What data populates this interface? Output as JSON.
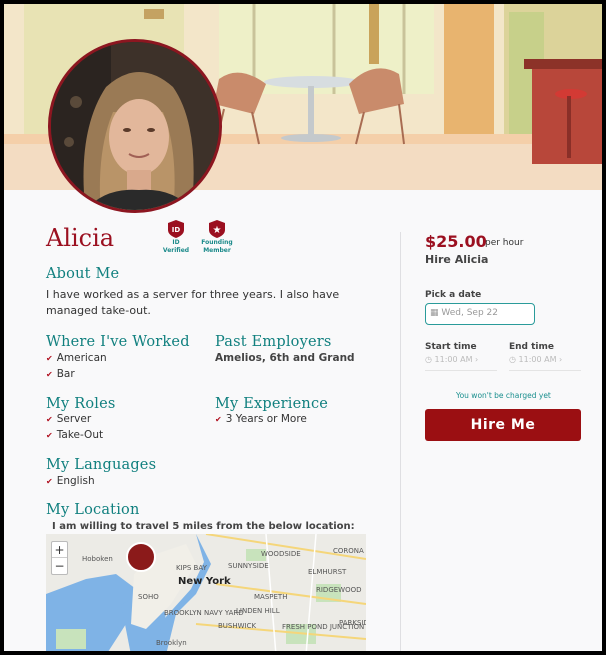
{
  "profile": {
    "name": "Alicia",
    "badges": [
      {
        "icon": "id-shield-icon",
        "label_line1": "ID",
        "label_line2": "Verified"
      },
      {
        "icon": "star-shield-icon",
        "label_line1": "Founding",
        "label_line2": "Member"
      }
    ]
  },
  "about": {
    "heading": "About Me",
    "text_line1": "I have worked as a server for three years. I also have",
    "text_line2": "managed take-out."
  },
  "worked": {
    "heading": "Where I've Worked",
    "items": [
      "American",
      "Bar"
    ]
  },
  "employers": {
    "heading": "Past Employers",
    "text": "Amelios, 6th and Grand"
  },
  "roles": {
    "heading": "My Roles",
    "items": [
      "Server",
      "Take-Out"
    ]
  },
  "experience": {
    "heading": "My Experience",
    "items": [
      "3 Years or More"
    ]
  },
  "languages": {
    "heading": "My Languages",
    "items": [
      "English"
    ]
  },
  "location": {
    "heading": "My Location",
    "note": "I am willing to travel 5 miles from the below location:",
    "map": {
      "city": "New York",
      "labels": [
        "Hoboken",
        "WOODSIDE",
        "SUNNYSIDE",
        "KIPS BAY",
        "ELMHURST",
        "CORONA",
        "RIDGEWOOD",
        "MASPETH",
        "LINDEN HILL",
        "FRESH POND JUNCTION",
        "BROOKLYN NAVY YARD",
        "BUSHWICK",
        "PARKSID",
        "SOHO",
        "Brooklyn"
      ],
      "zoom_in": "+",
      "zoom_out": "−"
    }
  },
  "booking": {
    "price": "$25.00",
    "per_hour": "per hour",
    "hire_subtitle": "Hire Alicia",
    "date_label": "Pick a date",
    "date_value": "Wed, Sep 22",
    "start_label": "Start time",
    "start_value": "11:00 AM",
    "end_label": "End time",
    "end_value": "11:00 AM",
    "not_charged": "You won't be charged yet",
    "hire_button": "Hire Me"
  },
  "colors": {
    "brand_red": "#9b1020",
    "teal": "#11807f",
    "button_red": "#9b0f12"
  }
}
